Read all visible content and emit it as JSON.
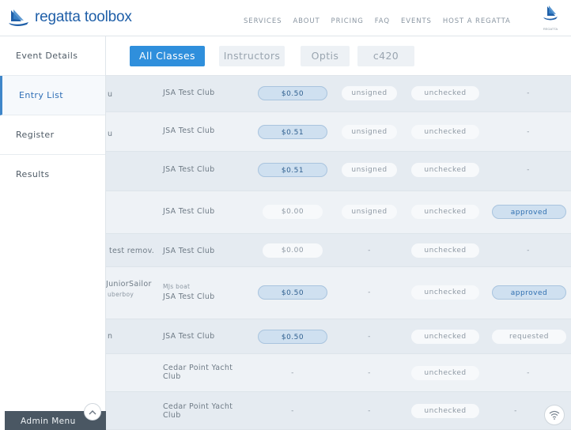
{
  "brand": {
    "name": "regatta toolbox",
    "corner_logo_label": "REGATTA"
  },
  "nav": [
    "SERVICES",
    "ABOUT",
    "PRICING",
    "FAQ",
    "EVENTS",
    "HOST A REGATTA"
  ],
  "sidebar": {
    "items": [
      {
        "label": "Event Details"
      },
      {
        "label": "Entry List"
      },
      {
        "label": "Register"
      },
      {
        "label": "Results"
      }
    ],
    "admin_menu": "Admin Menu"
  },
  "tabs": [
    "All Classes",
    "Instructors",
    "Optis",
    "c420"
  ],
  "rows": [
    {
      "name": "u",
      "club": "JSA Test Club",
      "boat": "",
      "fee": "$0.50",
      "waiver": "unsigned",
      "check": "unchecked",
      "status": "-"
    },
    {
      "name": "u",
      "club": "JSA Test Club",
      "boat": "",
      "fee": "$0.51",
      "waiver": "unsigned",
      "check": "unchecked",
      "status": "-"
    },
    {
      "name": "",
      "club": "JSA Test Club",
      "boat": "",
      "fee": "$0.51",
      "waiver": "unsigned",
      "check": "unchecked",
      "status": "-"
    },
    {
      "name": "",
      "club": "JSA Test Club",
      "boat": "",
      "fee": "$0.00",
      "waiver": "unsigned",
      "check": "unchecked",
      "status": "approved"
    },
    {
      "name": "test remov.",
      "club": "JSA Test Club",
      "boat": "",
      "fee": "$0.00",
      "waiver": "-",
      "check": "unchecked",
      "status": "-"
    },
    {
      "name": "JuniorSailor",
      "name2": "uberboy",
      "club": "JSA Test Club",
      "boat": "MJs boat",
      "fee": "$0.50",
      "waiver": "-",
      "check": "unchecked",
      "status": "approved"
    },
    {
      "name": "n",
      "club": "JSA Test Club",
      "boat": "",
      "fee": "$0.50",
      "waiver": "-",
      "check": "unchecked",
      "status": "requested"
    },
    {
      "name": "",
      "club": "Cedar Point Yacht Club",
      "boat": "",
      "fee": "-",
      "waiver": "-",
      "check": "unchecked",
      "status": "-"
    },
    {
      "name": "",
      "club": "Cedar Point Yacht Club",
      "boat": "",
      "fee": "-",
      "waiver": "-",
      "check": "unchecked",
      "status": "-"
    }
  ],
  "colors": {
    "accent": "#2f8fdc",
    "brand": "#1f5fa8",
    "pill_blue": "#cfe0f0",
    "admin_bg": "#4a5763"
  }
}
